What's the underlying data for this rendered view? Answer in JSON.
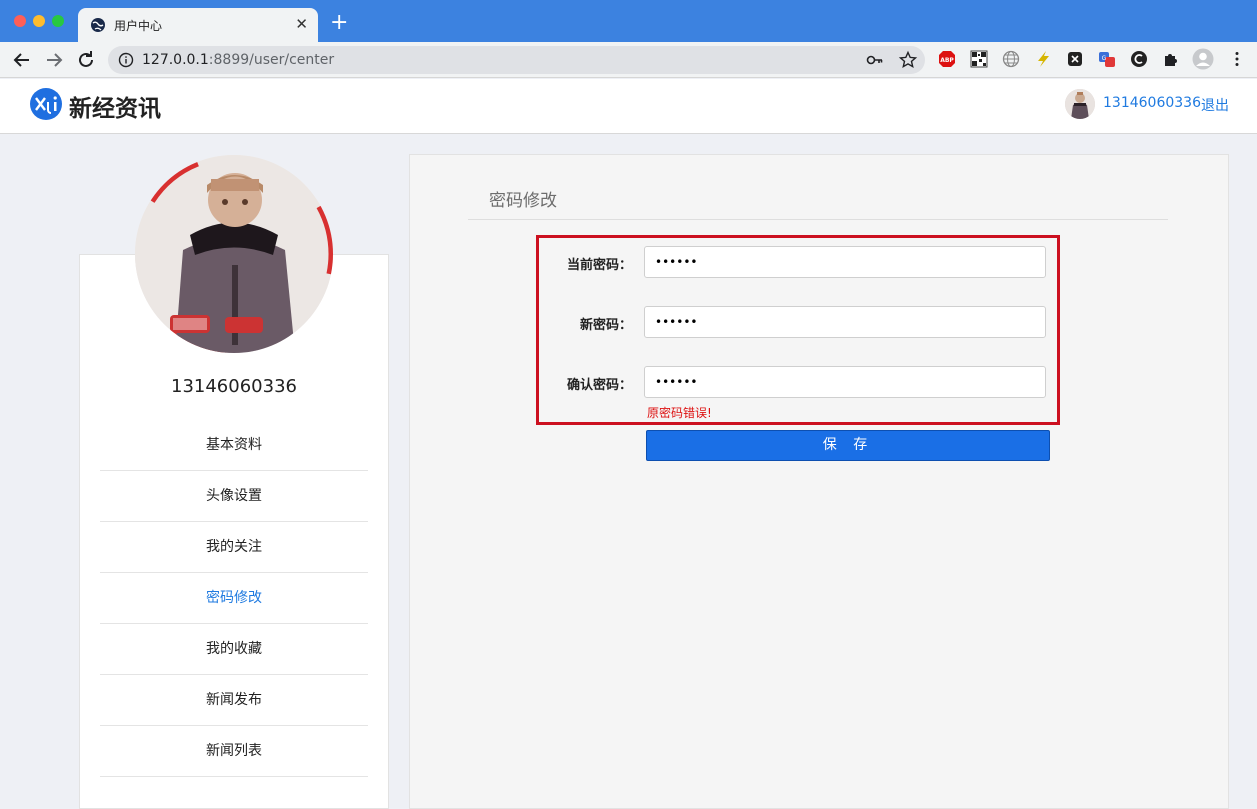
{
  "browser": {
    "tab_title": "用户中心",
    "tab_close": "✕",
    "new_tab": "+",
    "url_host": "127.0.0.1",
    "url_rest": ":8899/user/center"
  },
  "header": {
    "logo_text": "新经资讯",
    "username": "13146060336",
    "logout": "退出"
  },
  "sidebar": {
    "username": "13146060336",
    "items": [
      {
        "label": "基本资料"
      },
      {
        "label": "头像设置"
      },
      {
        "label": "我的关注"
      },
      {
        "label": "密码修改"
      },
      {
        "label": "我的收藏"
      },
      {
        "label": "新闻发布"
      },
      {
        "label": "新闻列表"
      }
    ],
    "active_index": 3
  },
  "form": {
    "title": "密码修改",
    "current_label": "当前密码：",
    "current_value": "••••••",
    "new_label": "新密码：",
    "new_value": "••••••",
    "confirm_label": "确认密码：",
    "confirm_value": "••••••",
    "error": "原密码错误!",
    "save": "保 存"
  },
  "colors": {
    "accent": "#1f7ae0",
    "button": "#1a6fe6",
    "highlight_border": "#cc1020",
    "error": "#dd1111"
  }
}
